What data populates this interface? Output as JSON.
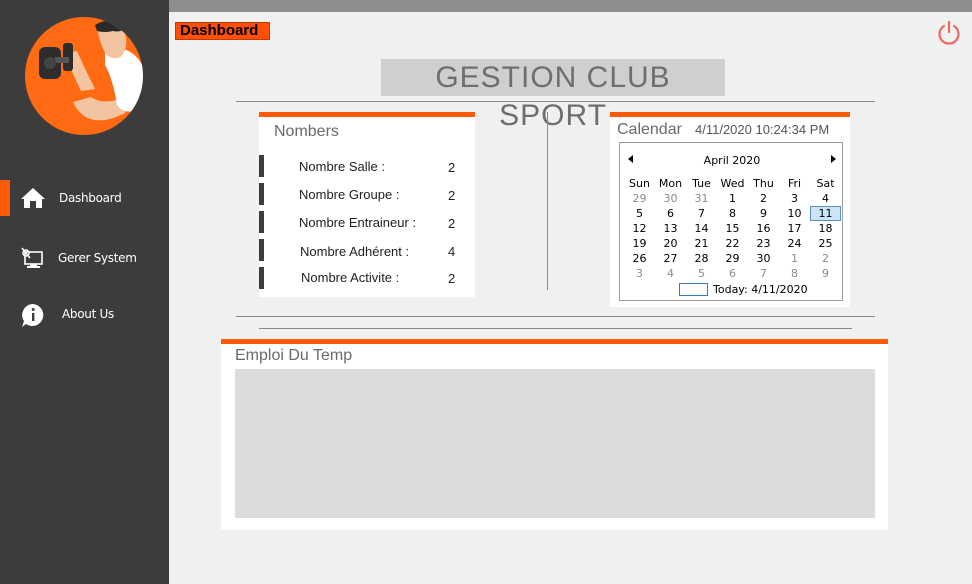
{
  "sidebar": {
    "items": [
      {
        "label": "Dashboard",
        "icon": "home-icon"
      },
      {
        "label": "Gerer System",
        "icon": "computer-settings-icon"
      },
      {
        "label": "About Us",
        "icon": "info-icon"
      }
    ]
  },
  "header": {
    "tab_label": "Dashboard",
    "title": "GESTION CLUB SPORT"
  },
  "nombers": {
    "title": "Nombers",
    "stats": [
      {
        "label": "Nombre Salle :",
        "value": "2"
      },
      {
        "label": "Nombre Groupe :",
        "value": "2"
      },
      {
        "label": "Nombre Entraineur :",
        "value": "2"
      },
      {
        "label": "Nombre Adhérent :",
        "value": "4"
      },
      {
        "label": "Nombre Activite :",
        "value": "2"
      }
    ]
  },
  "calendar": {
    "title": "Calendar",
    "datetime": "4/11/2020 10:24:34 PM",
    "month": "April 2020",
    "weekdays": [
      "Sun",
      "Mon",
      "Tue",
      "Wed",
      "Thu",
      "Fri",
      "Sat"
    ],
    "weeks": [
      [
        "29",
        "30",
        "31",
        "1",
        "2",
        "3",
        "4"
      ],
      [
        "5",
        "6",
        "7",
        "8",
        "9",
        "10",
        "11"
      ],
      [
        "12",
        "13",
        "14",
        "15",
        "16",
        "17",
        "18"
      ],
      [
        "19",
        "20",
        "21",
        "22",
        "23",
        "24",
        "25"
      ],
      [
        "26",
        "27",
        "28",
        "29",
        "30",
        "1",
        "2"
      ],
      [
        "3",
        "4",
        "5",
        "6",
        "7",
        "8",
        "9"
      ]
    ],
    "selected_day": "11",
    "today_text": "Today: 4/11/2020"
  },
  "emploi": {
    "title": "Emploi Du Temp"
  },
  "colors": {
    "accent": "#ff5a0a",
    "sidebar": "#3c3c3c",
    "background": "#f0f0f0"
  }
}
